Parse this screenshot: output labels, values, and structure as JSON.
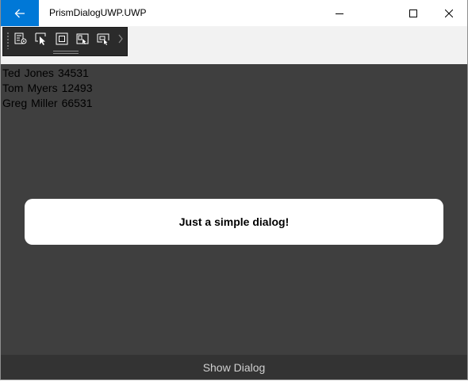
{
  "window": {
    "title": "PrismDialogUWP.UWP",
    "accent_color": "#0078d7"
  },
  "toolbar": {
    "tools": [
      "app-toolbar-icon",
      "select-element-icon",
      "display-layout-adorners-icon",
      "track-focused-element-icon",
      "display-layout-selection-icon"
    ],
    "overflow_icon": "chevron-right-icon"
  },
  "people": [
    {
      "first": "Ted",
      "last": "Jones",
      "number": "34531"
    },
    {
      "first": "Tom",
      "last": "Myers",
      "number": "12493"
    },
    {
      "first": "Greg",
      "last": "Miller",
      "number": "66531"
    }
  ],
  "dialog": {
    "message": "Just a simple dialog!"
  },
  "actions": {
    "show_dialog_label": "Show Dialog"
  },
  "colors": {
    "content_background": "#3f3f3f",
    "dialog_background": "#ffffff",
    "button_background": "#333333"
  }
}
